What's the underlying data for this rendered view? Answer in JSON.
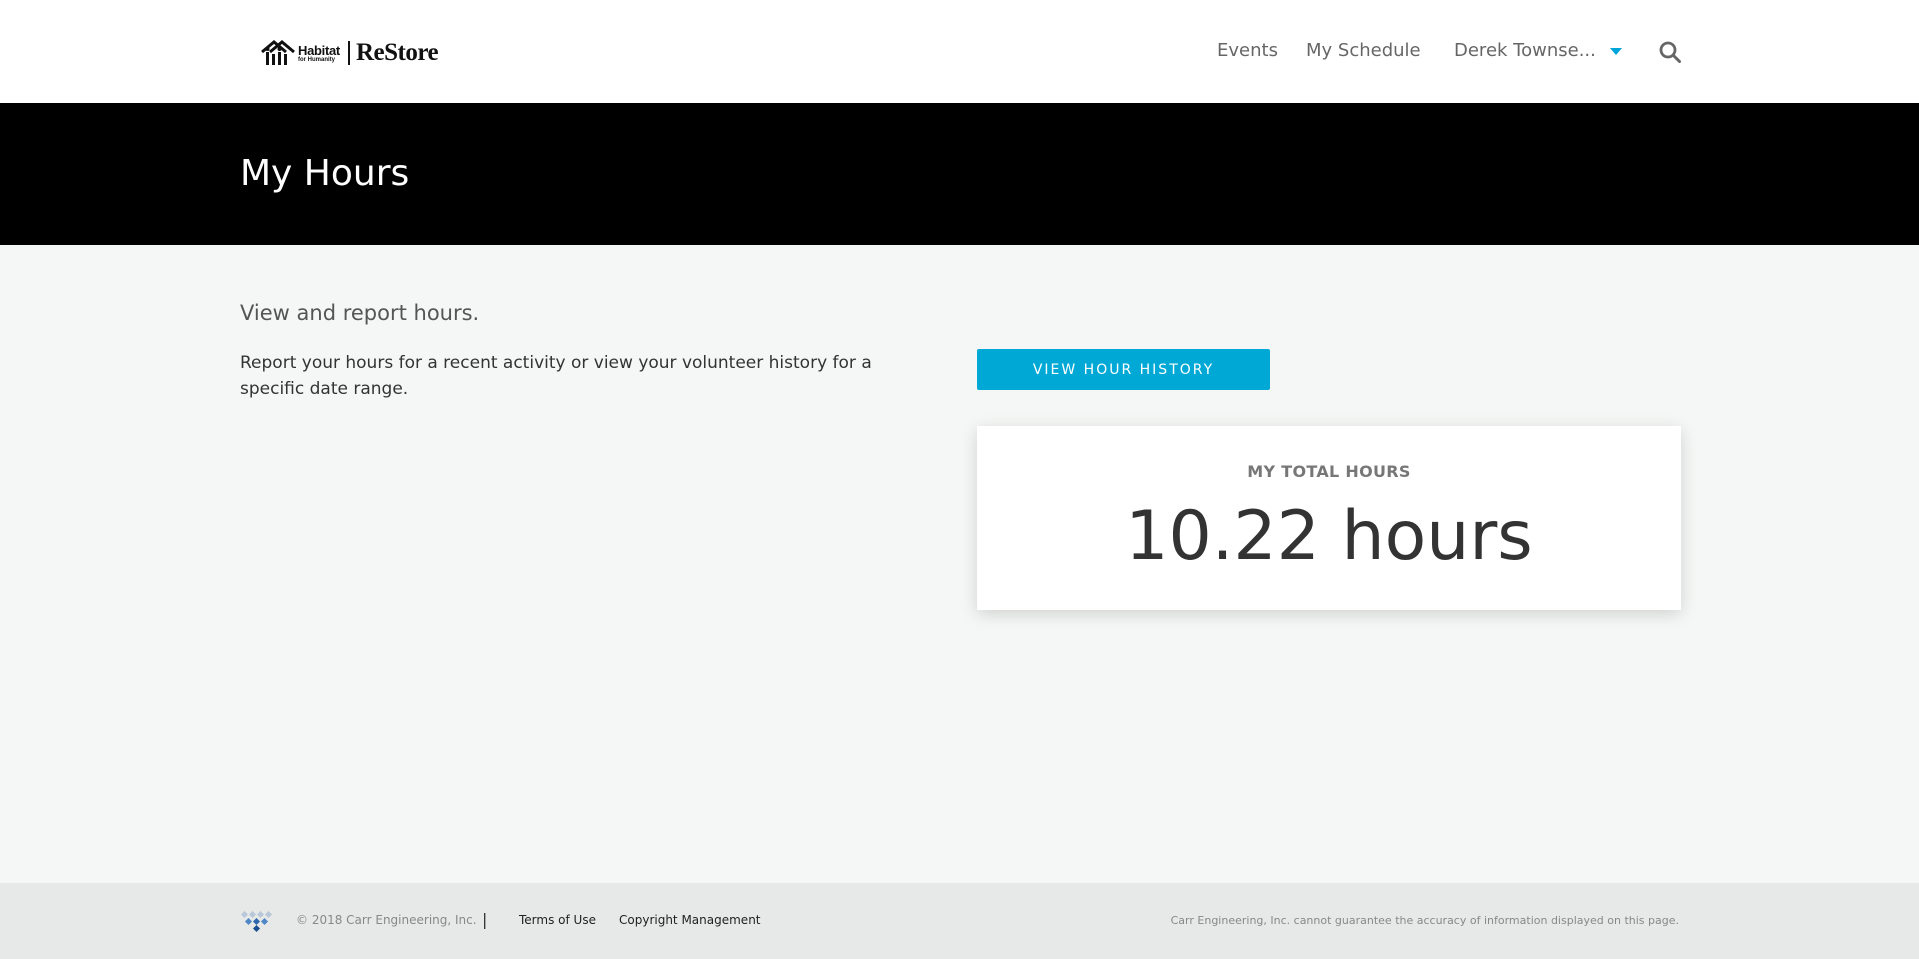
{
  "header": {
    "logo_habitat": "Habitat",
    "logo_habitat_sub": "for Humanity",
    "logo_restore": "ReStore",
    "nav": {
      "events": "Events",
      "schedule": "My Schedule",
      "user": "Derek Townse..."
    },
    "icons": {
      "search": "search-icon",
      "user_menu": "chevron-down-icon"
    },
    "accent_color": "#00a8d6"
  },
  "banner": {
    "title": "My Hours"
  },
  "main": {
    "heading": "View and report hours.",
    "description": "Report your hours for a recent activity or view your volunteer history for a specific date range.",
    "history_button": "VIEW HOUR HISTORY",
    "total_label": "MY TOTAL HOURS",
    "total_value": "10.22 hours"
  },
  "footer": {
    "copyright": "© 2018 Carr Engineering, Inc.",
    "divider": "|",
    "terms": "Terms of Use",
    "copyright_management": "Copyright Management",
    "disclaimer": "Carr Engineering, Inc. cannot guarantee the accuracy of information displayed on this page."
  }
}
